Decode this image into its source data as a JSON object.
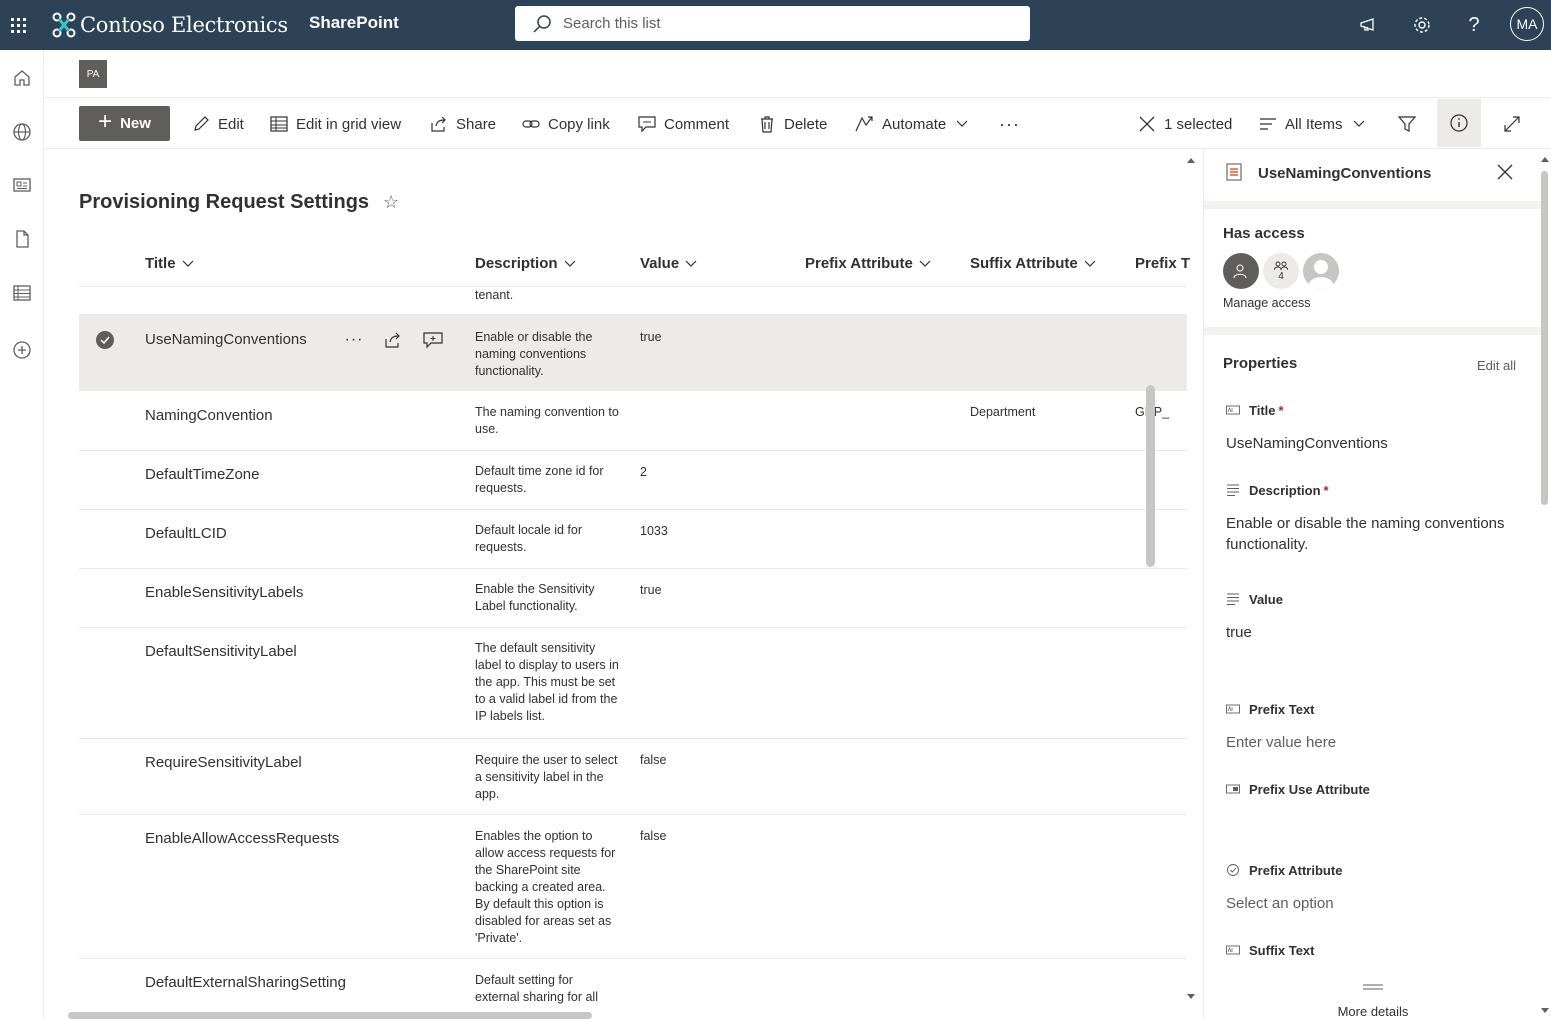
{
  "suite": {
    "brand": "Contoso Electronics",
    "app": "SharePoint",
    "search_placeholder": "Search this list",
    "user_initials": "MA"
  },
  "site": {
    "logo_text": "PA"
  },
  "commands": {
    "new": "New",
    "edit": "Edit",
    "grid": "Edit in grid view",
    "share": "Share",
    "copy_link": "Copy link",
    "comment": "Comment",
    "delete": "Delete",
    "automate": "Automate",
    "more": "···",
    "selected": "1 selected",
    "view": "All Items"
  },
  "list": {
    "title": "Provisioning Request Settings",
    "star": "☆",
    "columns": [
      "Title",
      "Description",
      "Value",
      "Prefix Attribute",
      "Suffix Attribute",
      "Prefix T"
    ],
    "partial_row_desc": "tenant.",
    "rows": [
      {
        "title": "UseNamingConventions",
        "desc": "Enable or disable the naming conventions functionality.",
        "value": "true",
        "suffix": "",
        "prefix_text": ""
      },
      {
        "title": "NamingConvention",
        "desc": "The naming convention to use.",
        "value": "",
        "suffix": "Department",
        "prefix_text": "GRP_"
      },
      {
        "title": "DefaultTimeZone",
        "desc": "Default time zone id for requests.",
        "value": "2",
        "suffix": "",
        "prefix_text": ""
      },
      {
        "title": "DefaultLCID",
        "desc": "Default locale id for requests.",
        "value": "1033",
        "suffix": "",
        "prefix_text": ""
      },
      {
        "title": "EnableSensitivityLabels",
        "desc": "Enable the Sensitivity Label functionality.",
        "value": "true",
        "suffix": "",
        "prefix_text": ""
      },
      {
        "title": "DefaultSensitivityLabel",
        "desc": "The default sensitivity label to display to users in the app. This must be set to a valid label id from the IP labels list.",
        "value": "",
        "suffix": "",
        "prefix_text": ""
      },
      {
        "title": "RequireSensitivityLabel",
        "desc": "Require the user to select a sensitivity label in the app.",
        "value": "false",
        "suffix": "",
        "prefix_text": ""
      },
      {
        "title": "EnableAllowAccessRequests",
        "desc": "Enables the option to allow access requests for the SharePoint site backing a created area. By default this option is disabled for areas set as 'Private'.",
        "value": "false",
        "suffix": "",
        "prefix_text": ""
      },
      {
        "title": "DefaultExternalSharingSetting",
        "desc": "Default setting for external sharing for all",
        "value": "",
        "suffix": "",
        "prefix_text": ""
      }
    ]
  },
  "panel": {
    "title": "UseNamingConventions",
    "has_access": "Has access",
    "group_count": "4",
    "manage_access": "Manage access",
    "properties": "Properties",
    "edit_all": "Edit all",
    "required_mark": "*",
    "fields": {
      "title_label": "Title",
      "title_value": "UseNamingConventions",
      "desc_label": "Description",
      "desc_value": "Enable or disable the naming conventions functionality.",
      "value_label": "Value",
      "value_value": "true",
      "prefix_text_label": "Prefix Text",
      "prefix_text_placeholder": "Enter value here",
      "prefix_use_label": "Prefix Use Attribute",
      "prefix_attr_label": "Prefix Attribute",
      "prefix_attr_placeholder": "Select an option",
      "suffix_text_label": "Suffix Text"
    },
    "more_details": "More details"
  }
}
